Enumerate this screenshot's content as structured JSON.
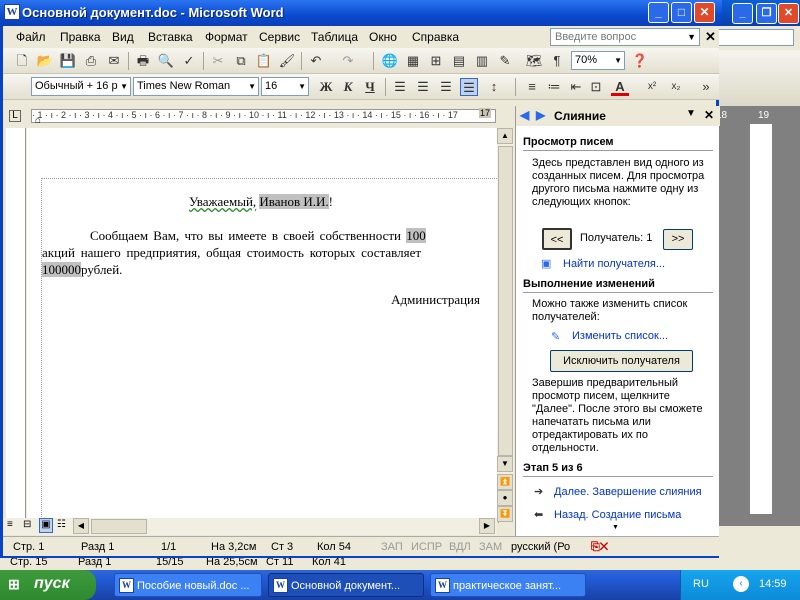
{
  "window": {
    "title": "Основной документ.doc - Microsoft Word",
    "icon": "W"
  },
  "menu": {
    "items": [
      "Файл",
      "Правка",
      "Вид",
      "Вставка",
      "Формат",
      "Сервис",
      "Таблица",
      "Окно",
      "Справка"
    ],
    "ask_placeholder": "Введите вопрос"
  },
  "toolbar": {
    "zoom": "70%",
    "style": "Обычный + 16 р",
    "font": "Times New Roman",
    "size": "16",
    "bold": "Ж",
    "italic": "К",
    "underline": "Ч",
    "pilcrow": "¶"
  },
  "ruler": {
    "marks": "· 1 · ı · 2 · ı · 3 · ı · 4 · ı · 5 · ı · 6 · ı · 7 · ı · 8 · ı · 9 · ı · 10 · ı · 11 · ı · 12 · ı · 13 · ı · 14 · ı · 15 · ı · 16 · ı · 17",
    "end_mark": "17"
  },
  "document": {
    "greeting_prefix": "Уважаемый,",
    "greeting_field": "Иванов И.И.",
    "greeting_suffix": "!",
    "para_line1_text": "Сообщаем Вам, что вы имеете в своей собственности",
    "para_line1_field": "100",
    "para_line2": "акций нашего предприятия, общая стоимость которых составляет",
    "para_line3_field": "100000",
    "para_line3_text": "рублей.",
    "signature": "Администрация"
  },
  "pane": {
    "title": "Слияние",
    "section1": "Просмотр писем",
    "text1": "Здесь представлен вид одного из созданных писем. Для просмотра другого письма нажмите одну из следующих кнопок:",
    "prev_button": "<<",
    "recipient_label": "Получатель: 1",
    "next_button": ">>",
    "find_link": "Найти получателя...",
    "section2": "Выполнение изменений",
    "text2": "Можно также изменить список получателей:",
    "edit_link": "Изменить список...",
    "exclude_button": "Исключить получателя",
    "text3": "Завершив предварительный просмотр писем, щелкните \"Далее\". После этого вы сможете напечатать письма или отредактировать их по отдельности.",
    "step": "Этап 5 из 6",
    "next_link": "Далее. Завершение слияния",
    "back_link": "Назад. Создание письма"
  },
  "status": {
    "page": "Стр. 1",
    "section": "Разд 1",
    "pages": "1/1",
    "at": "На 3,2см",
    "line": "Ст 3",
    "col": "Кол 54",
    "rec": "ЗАП",
    "trk": "ИСПР",
    "ext": "ВДЛ",
    "ovr": "ЗАМ",
    "lang": "русский (Ро"
  },
  "back_status": {
    "page": "Стр. 15",
    "section": "Разд 1",
    "pages": "15/15",
    "at": "На 25,5см",
    "line": "Ст 11",
    "col": "Кол 41"
  },
  "bg_window": {
    "ask": "Введите вопрос",
    "ruler_a": "18",
    "ruler_b": "19"
  },
  "taskbar": {
    "start": "пуск",
    "tasks": [
      "Пособие новый.doc ...",
      "Основной документ...",
      "практическое занят..."
    ],
    "lang": "RU",
    "clock": "14:59"
  },
  "colors": {
    "title_blue": "#0a4ad0",
    "field_gray": "#c0c0c0",
    "link_blue": "#0033cc",
    "taskbar": "#245edc",
    "start_green": "#3c9a3c"
  }
}
